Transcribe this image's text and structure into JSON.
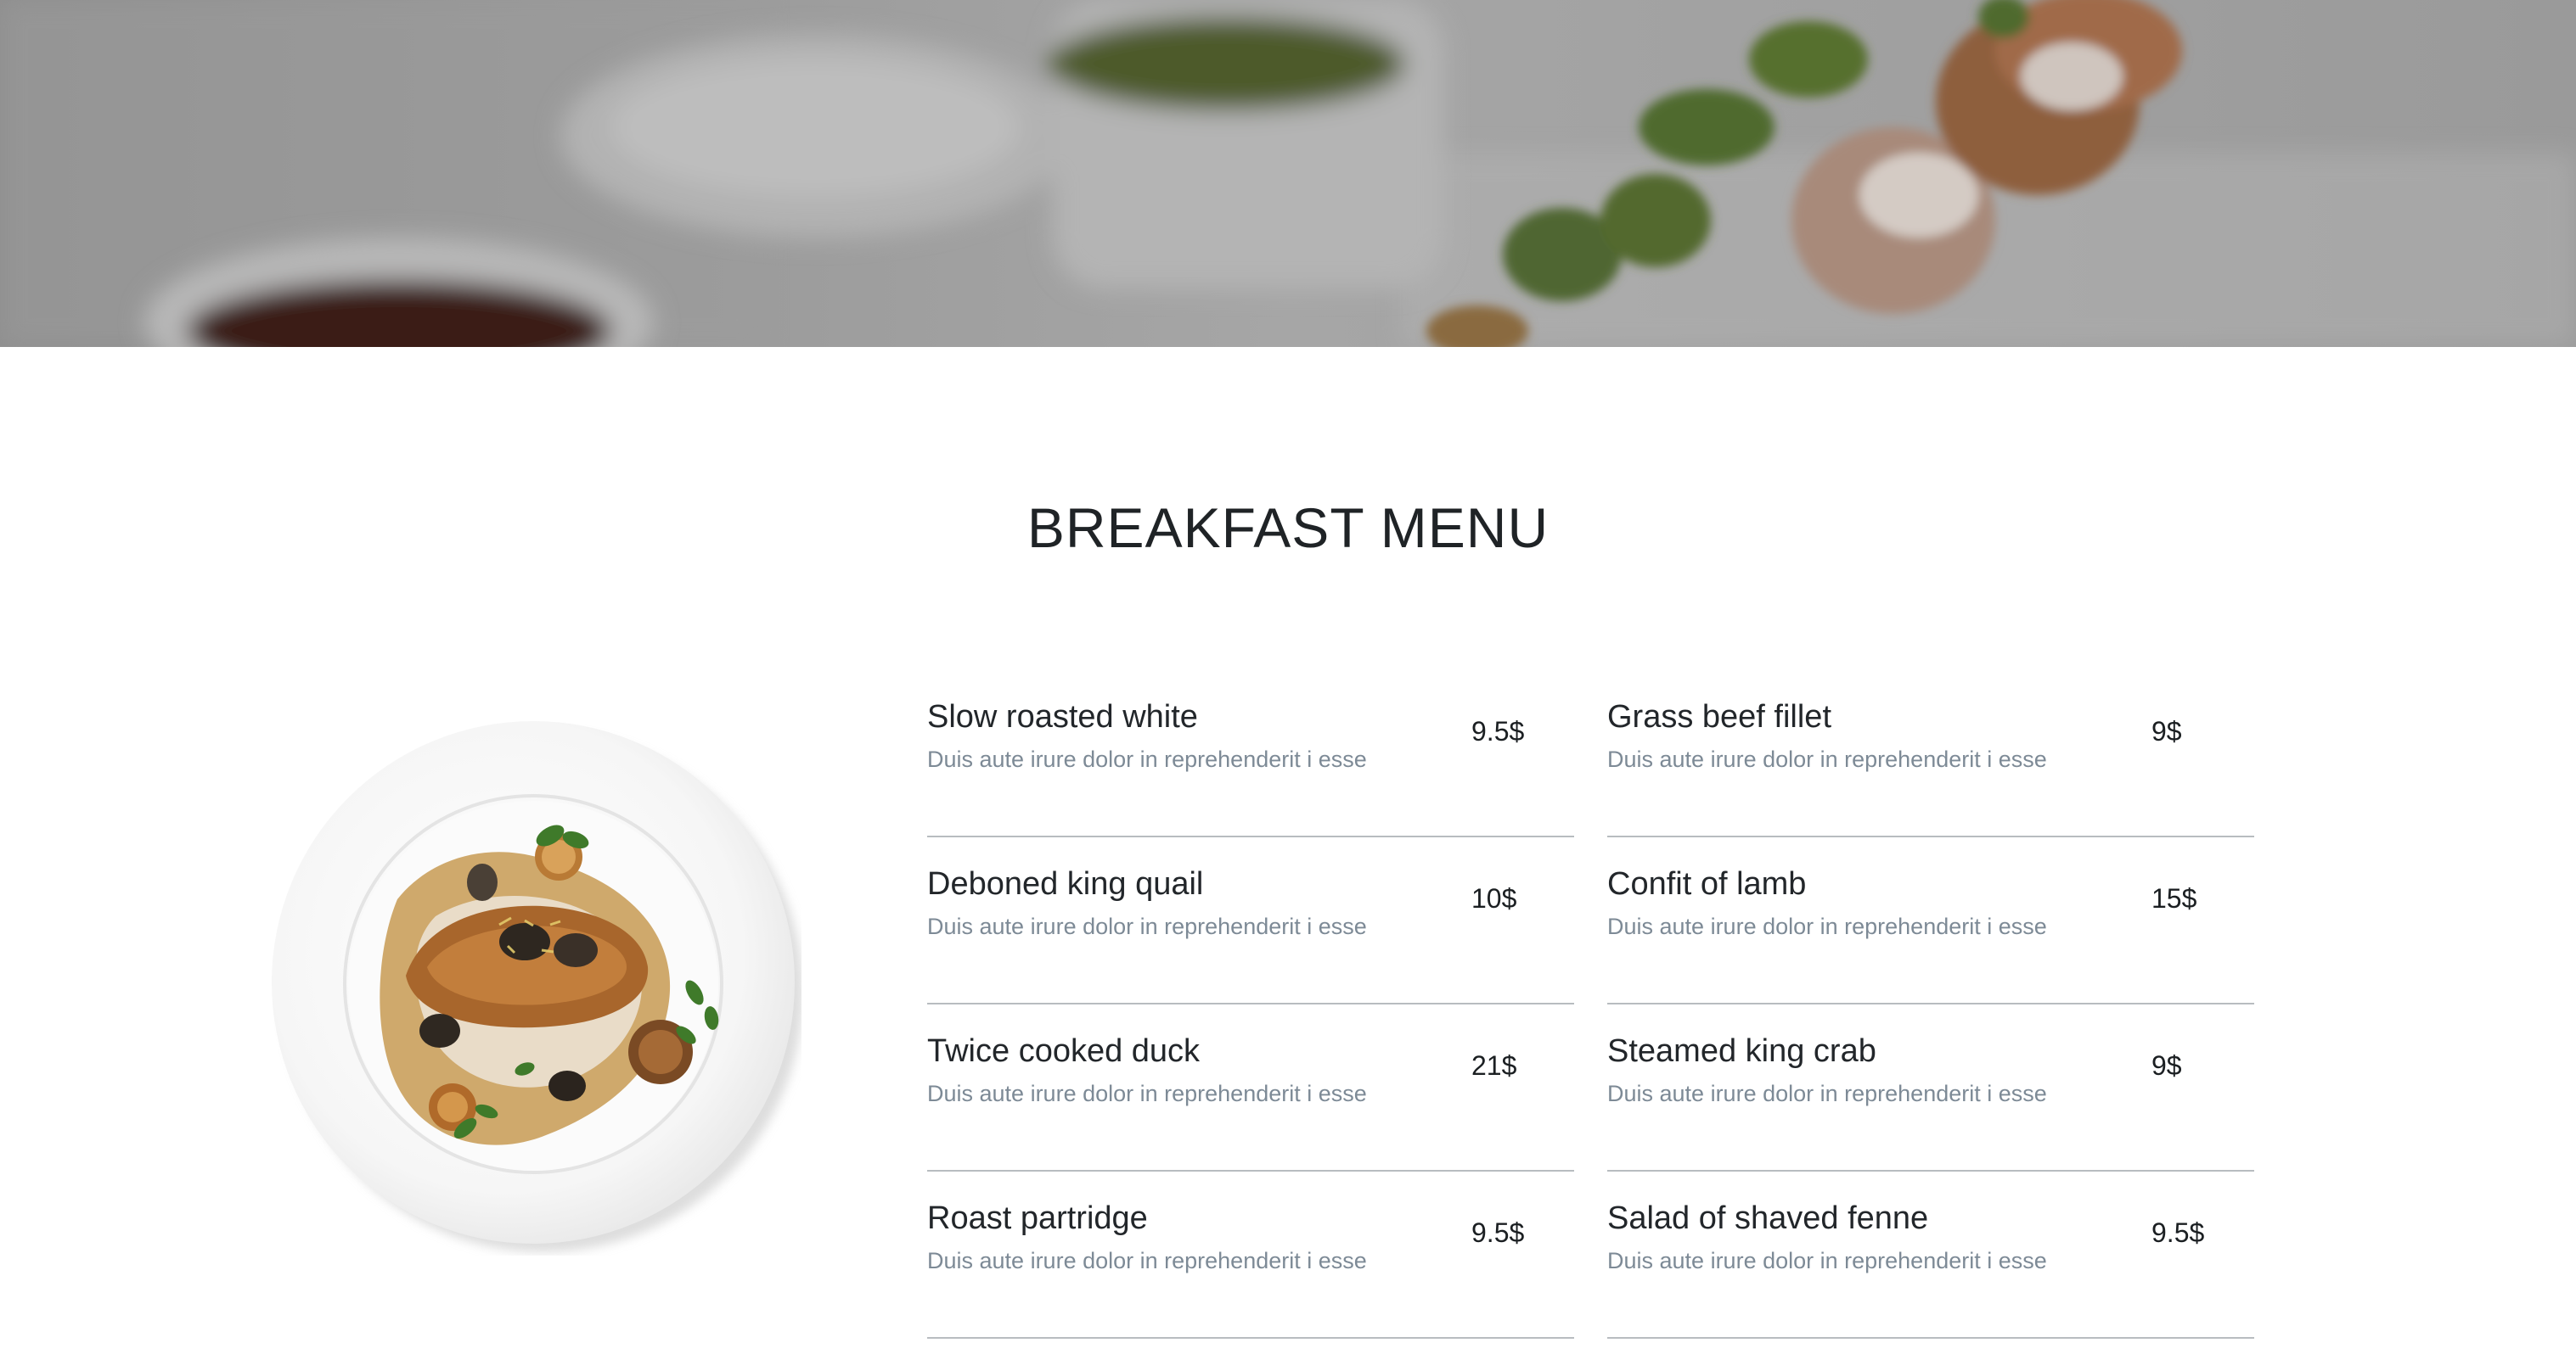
{
  "hero": {
    "image": "blurred-breakfast-dishes-photo"
  },
  "section": {
    "title": "BREAKFAST MENU"
  },
  "plate": {
    "image": "plated-roast-dish-photo"
  },
  "menu": {
    "left": [
      {
        "name": "Slow roasted white",
        "description": "Duis aute irure dolor in reprehenderit i esse",
        "price": "9.5$"
      },
      {
        "name": "Deboned king quail",
        "description": "Duis aute irure dolor in reprehenderit i esse",
        "price": "10$"
      },
      {
        "name": "Twice cooked duck",
        "description": "Duis aute irure dolor in reprehenderit i esse",
        "price": "21$"
      },
      {
        "name": "Roast partridge",
        "description": "Duis aute irure dolor in reprehenderit i esse",
        "price": "9.5$"
      }
    ],
    "right": [
      {
        "name": "Grass beef fillet",
        "description": "Duis aute irure dolor in reprehenderit i esse",
        "price": "9$"
      },
      {
        "name": "Confit of lamb",
        "description": "Duis aute irure dolor in reprehenderit i esse",
        "price": "15$"
      },
      {
        "name": "Steamed king crab",
        "description": "Duis aute irure dolor in reprehenderit i esse",
        "price": "9$"
      },
      {
        "name": "Salad of shaved fenne",
        "description": "Duis aute irure dolor in reprehenderit i esse",
        "price": "9.5$"
      }
    ]
  },
  "colors": {
    "heading": "#1f2326",
    "description": "#7d8a96",
    "divider": "#b8bcc0"
  }
}
